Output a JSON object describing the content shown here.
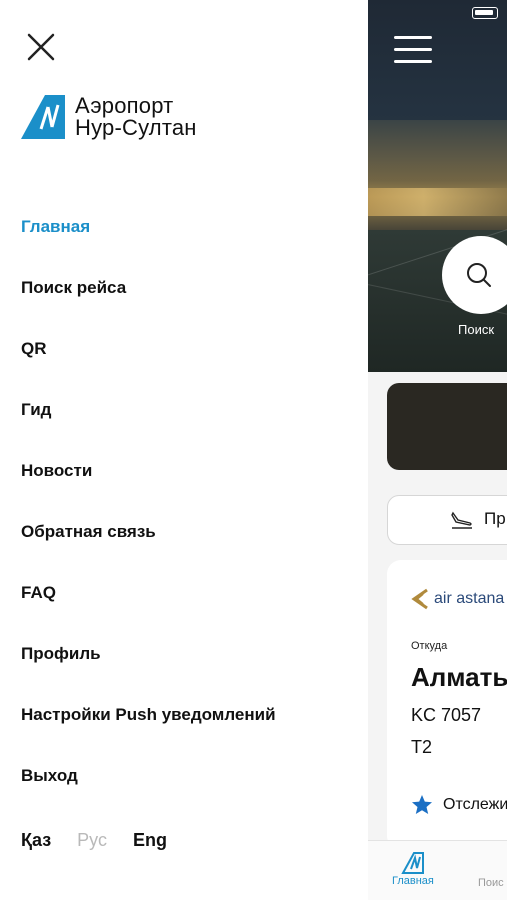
{
  "drawer": {
    "logo_line1": "Аэропорт",
    "logo_line2": "Нур-Султан",
    "menu": [
      {
        "label": "Главная",
        "active": true
      },
      {
        "label": "Поиск рейса"
      },
      {
        "label": "QR"
      },
      {
        "label": "Гид"
      },
      {
        "label": "Новости"
      },
      {
        "label": "Обратная связь"
      },
      {
        "label": "FAQ"
      },
      {
        "label": "Профиль"
      },
      {
        "label": "Настройки Push уведомлений"
      },
      {
        "label": "Выход"
      }
    ],
    "languages": {
      "kaz": "Қаз",
      "rus": "Рус",
      "eng": "Eng",
      "selected": "Рус"
    }
  },
  "app": {
    "search_label": "Поиск",
    "pill_text": "Пр",
    "flight": {
      "airline": "air astana",
      "from_label": "Откуда",
      "city": "Алматы",
      "flight_no": "KC 7057",
      "terminal": "T2",
      "track_label": "Отслеживать"
    },
    "tabs": {
      "home": "Главная",
      "search": "Поис"
    }
  },
  "colors": {
    "accent": "#1b8fc9",
    "inactive_lang": "#b9b9b9"
  }
}
